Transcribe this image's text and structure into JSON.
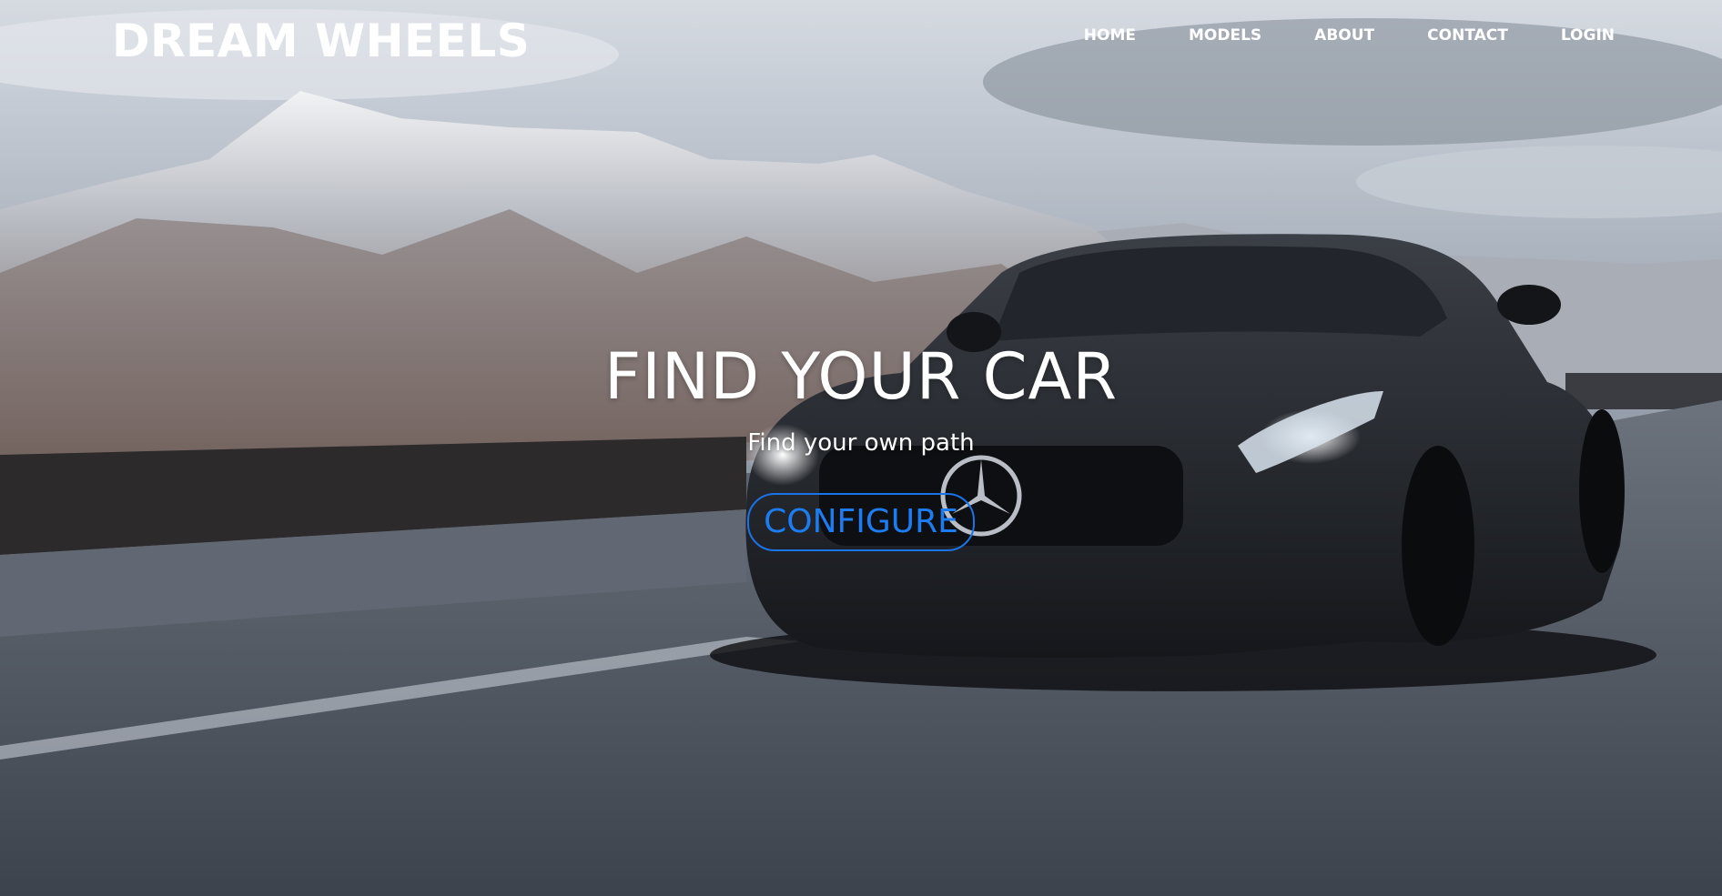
{
  "brand": {
    "name": "DREAM WHEELS"
  },
  "nav": {
    "items": [
      {
        "label": "HOME"
      },
      {
        "label": "MODELS"
      },
      {
        "label": "ABOUT"
      },
      {
        "label": "CONTACT"
      },
      {
        "label": "LOGIN"
      }
    ]
  },
  "hero": {
    "title": "FIND YOUR CAR",
    "subtitle": "Find your own path",
    "button_label": "CONFIGURE",
    "background_image": "car-on-mountain-road"
  },
  "colors": {
    "text": "#ffffff",
    "button_accent": "#1a73e8",
    "sky": "#c9cfd8",
    "road": "#4a525c"
  }
}
